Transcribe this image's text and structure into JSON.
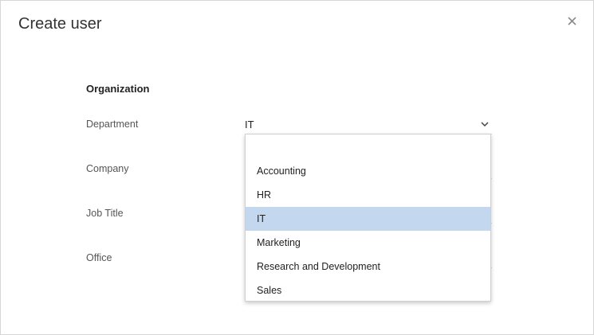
{
  "dialog": {
    "title": "Create user",
    "close_icon": "close-icon"
  },
  "section": {
    "title": "Organization"
  },
  "fields": {
    "department": {
      "label": "Department",
      "value": "IT"
    },
    "company": {
      "label": "Company"
    },
    "job_title": {
      "label": "Job Title"
    },
    "office": {
      "label": "Office"
    }
  },
  "dropdown": {
    "options": [
      "Accounting",
      "HR",
      "IT",
      "Marketing",
      "Research and Development",
      "Sales"
    ],
    "selected": "IT",
    "highlight_color": "#c3d7ef"
  }
}
